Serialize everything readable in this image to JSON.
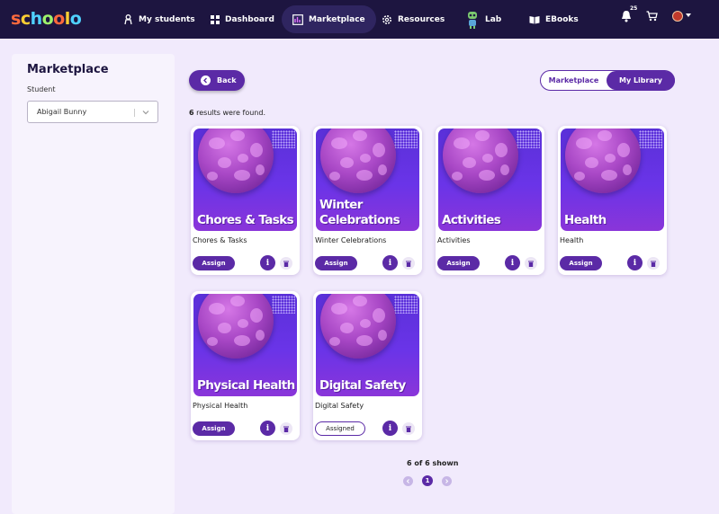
{
  "app": {
    "logo_text": [
      "s",
      "c",
      "h",
      "o",
      "o",
      "l",
      "o"
    ]
  },
  "nav": {
    "items": [
      {
        "label": "My students",
        "icon": "student-icon"
      },
      {
        "label": "Dashboard",
        "icon": "dashboard-grid-icon"
      },
      {
        "label": "Marketplace",
        "icon": "marketplace-icon",
        "active": true
      },
      {
        "label": "Resources",
        "icon": "gear-icon"
      },
      {
        "label": "Lab",
        "icon": "robot-icon"
      },
      {
        "label": "EBooks",
        "icon": "book-icon"
      }
    ],
    "notification_count": "25",
    "icons": [
      "bell-icon",
      "cart-icon",
      "avatar"
    ]
  },
  "sidebar": {
    "title": "Marketplace",
    "student_label": "Student",
    "student_value": "Abigail Bunny"
  },
  "toolbar": {
    "back_label": "Back",
    "toggle": {
      "option1": "Marketplace",
      "option2": "My Library",
      "selected": "My Library"
    }
  },
  "results": {
    "count": "6",
    "text": " results were found."
  },
  "cards": [
    {
      "title": "Chores & Tasks",
      "name": "Chores & Tasks",
      "button": "Assign"
    },
    {
      "title": "Winter Celebrations",
      "name": "Winter Celebrations",
      "button": "Assign"
    },
    {
      "title": "Activities",
      "name": "Activities",
      "button": "Assign"
    },
    {
      "title": "Health",
      "name": "Health",
      "button": "Assign"
    },
    {
      "title": "Physical Health",
      "name": "Physical Health",
      "button": "Assign"
    },
    {
      "title": "Digital Safety",
      "name": "Digital Safety",
      "button": "Assigned"
    }
  ],
  "pagination": {
    "summary": "6 of 6 shown",
    "current_page": "1"
  },
  "colors": {
    "nav_bg": "#1d1540",
    "accent": "#5b2aa6",
    "page_bg": "#f1eafc"
  }
}
